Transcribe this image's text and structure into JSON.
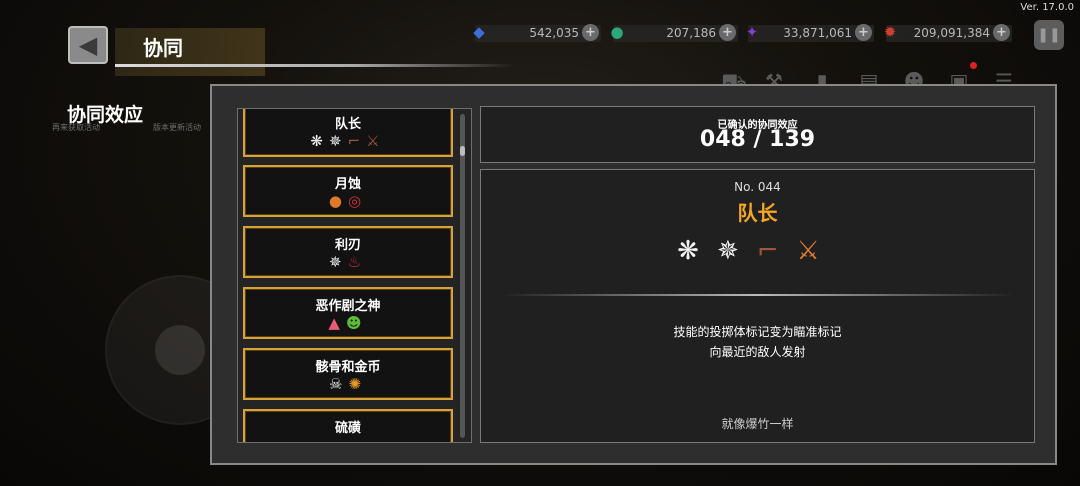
{
  "app": {
    "version": "Ver. 17.0.0"
  },
  "header": {
    "back_icon": "back-arrow-icon",
    "title": "协同"
  },
  "currencies": [
    {
      "name": "diamond",
      "icon": "diamond-icon",
      "value": "542,035",
      "color": "#3b6fd6"
    },
    {
      "name": "green-gem",
      "icon": "green-orb-icon",
      "value": "207,186",
      "color": "#2aa87a"
    },
    {
      "name": "soul",
      "icon": "purple-crystal-icon",
      "value": "33,871,061",
      "color": "#8a3bd6"
    },
    {
      "name": "core",
      "icon": "red-ember-icon",
      "value": "209,091,384",
      "color": "#d04030"
    }
  ],
  "toolbar": {
    "icons": [
      "cart-icon",
      "hammer-icon",
      "book-icon",
      "cards-icon",
      "ghost-icon",
      "chat-icon",
      "menu-icon"
    ]
  },
  "section": {
    "title": "协同效应",
    "caption_left": "再来获取活动",
    "caption_right": "版本更新活动"
  },
  "synergy_list": [
    {
      "name": "队长",
      "icons": [
        {
          "glyph": "❋",
          "color": "white",
          "name": "burst-icon"
        },
        {
          "glyph": "✵",
          "color": "white",
          "name": "spider-icon"
        },
        {
          "glyph": "⌐",
          "color": "brown",
          "name": "pistol-icon"
        },
        {
          "glyph": "⚔",
          "color": "brown",
          "name": "crossed-swords-icon"
        }
      ]
    },
    {
      "name": "月蚀",
      "icons": [
        {
          "glyph": "●",
          "color": "orange",
          "name": "fire-orb-icon"
        },
        {
          "glyph": "◎",
          "color": "red",
          "name": "red-ring-icon"
        }
      ]
    },
    {
      "name": "利刃",
      "icons": [
        {
          "glyph": "✵",
          "color": "white",
          "name": "spider-icon"
        },
        {
          "glyph": "♨",
          "color": "red",
          "name": "potion-icon"
        }
      ]
    },
    {
      "name": "恶作剧之神",
      "icons": [
        {
          "glyph": "▲",
          "color": "pink",
          "name": "shoe-icon"
        },
        {
          "glyph": "☻",
          "color": "green",
          "name": "mask-icon"
        }
      ]
    },
    {
      "name": "骸骨和金币",
      "icons": [
        {
          "glyph": "☠",
          "color": "white",
          "name": "skull-icon"
        },
        {
          "glyph": "✺",
          "color": "gold",
          "name": "coin-icon"
        }
      ]
    },
    {
      "name": "硫磺",
      "icons": []
    }
  ],
  "count": {
    "label": "已确认的协同效应",
    "value": "048 / 139"
  },
  "detail": {
    "number": "No. 044",
    "name": "队长",
    "icons": [
      {
        "glyph": "❋",
        "color": "white",
        "name": "burst-icon"
      },
      {
        "glyph": "✵",
        "color": "white",
        "name": "spider-icon"
      },
      {
        "glyph": "⌐",
        "color": "brown",
        "name": "pistol-icon"
      },
      {
        "glyph": "⚔",
        "color": "brown",
        "name": "crossed-swords-icon"
      }
    ],
    "desc_line1": "技能的投掷体标记变为瞄准标记",
    "desc_line2": "向最近的敌人发射",
    "flavor": "就像爆竹一样"
  }
}
